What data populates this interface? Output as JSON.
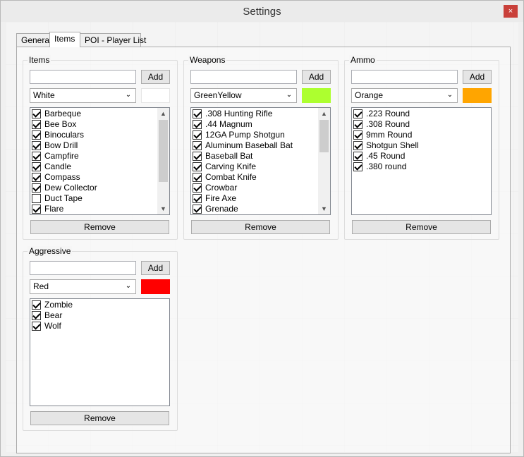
{
  "window": {
    "title": "Settings",
    "close_glyph": "×"
  },
  "tabs": [
    {
      "label": "General",
      "active": false
    },
    {
      "label": "Items",
      "active": true
    },
    {
      "label": "POI - Player List",
      "active": false
    }
  ],
  "groups": {
    "items": {
      "title": "Items",
      "add_label": "Add",
      "input_value": "",
      "color_name": "White",
      "color_hex": "#ffffff",
      "remove_label": "Remove",
      "entries": [
        {
          "label": "Barbeque",
          "checked": true
        },
        {
          "label": "Bee Box",
          "checked": true
        },
        {
          "label": "Binoculars",
          "checked": true
        },
        {
          "label": "Bow Drill",
          "checked": true
        },
        {
          "label": "Campfire",
          "checked": true
        },
        {
          "label": "Candle",
          "checked": true
        },
        {
          "label": "Compass",
          "checked": true
        },
        {
          "label": "Dew Collector",
          "checked": true
        },
        {
          "label": "Duct Tape",
          "checked": false
        },
        {
          "label": "Flare",
          "checked": true
        }
      ]
    },
    "weapons": {
      "title": "Weapons",
      "add_label": "Add",
      "input_value": "",
      "color_name": "GreenYellow",
      "color_hex": "#adff2f",
      "remove_label": "Remove",
      "entries": [
        {
          "label": ".308 Hunting Rifle",
          "checked": true
        },
        {
          "label": ".44 Magnum",
          "checked": true
        },
        {
          "label": "12GA Pump Shotgun",
          "checked": true
        },
        {
          "label": "Aluminum Baseball Bat",
          "checked": true
        },
        {
          "label": "Baseball Bat",
          "checked": true
        },
        {
          "label": "Carving Knife",
          "checked": true
        },
        {
          "label": "Combat Knife",
          "checked": true
        },
        {
          "label": "Crowbar",
          "checked": true
        },
        {
          "label": "Fire Axe",
          "checked": true
        },
        {
          "label": "Grenade",
          "checked": true
        }
      ]
    },
    "ammo": {
      "title": "Ammo",
      "add_label": "Add",
      "input_value": "",
      "color_name": "Orange",
      "color_hex": "#ffa500",
      "remove_label": "Remove",
      "entries": [
        {
          "label": ".223 Round",
          "checked": true
        },
        {
          "label": ".308 Round",
          "checked": true
        },
        {
          "label": "9mm Round",
          "checked": true
        },
        {
          "label": "Shotgun Shell",
          "checked": true
        },
        {
          "label": ".45 Round",
          "checked": true
        },
        {
          "label": ".380 round",
          "checked": true
        }
      ]
    },
    "aggressive": {
      "title": "Aggressive",
      "add_label": "Add",
      "input_value": "",
      "color_name": "Red",
      "color_hex": "#ff0000",
      "remove_label": "Remove",
      "entries": [
        {
          "label": "Zombie",
          "checked": true
        },
        {
          "label": "Bear",
          "checked": true
        },
        {
          "label": "Wolf",
          "checked": true
        }
      ]
    }
  },
  "icons": {
    "chevron_down": "⌄",
    "scroll_up": "▲",
    "scroll_down": "▼"
  }
}
